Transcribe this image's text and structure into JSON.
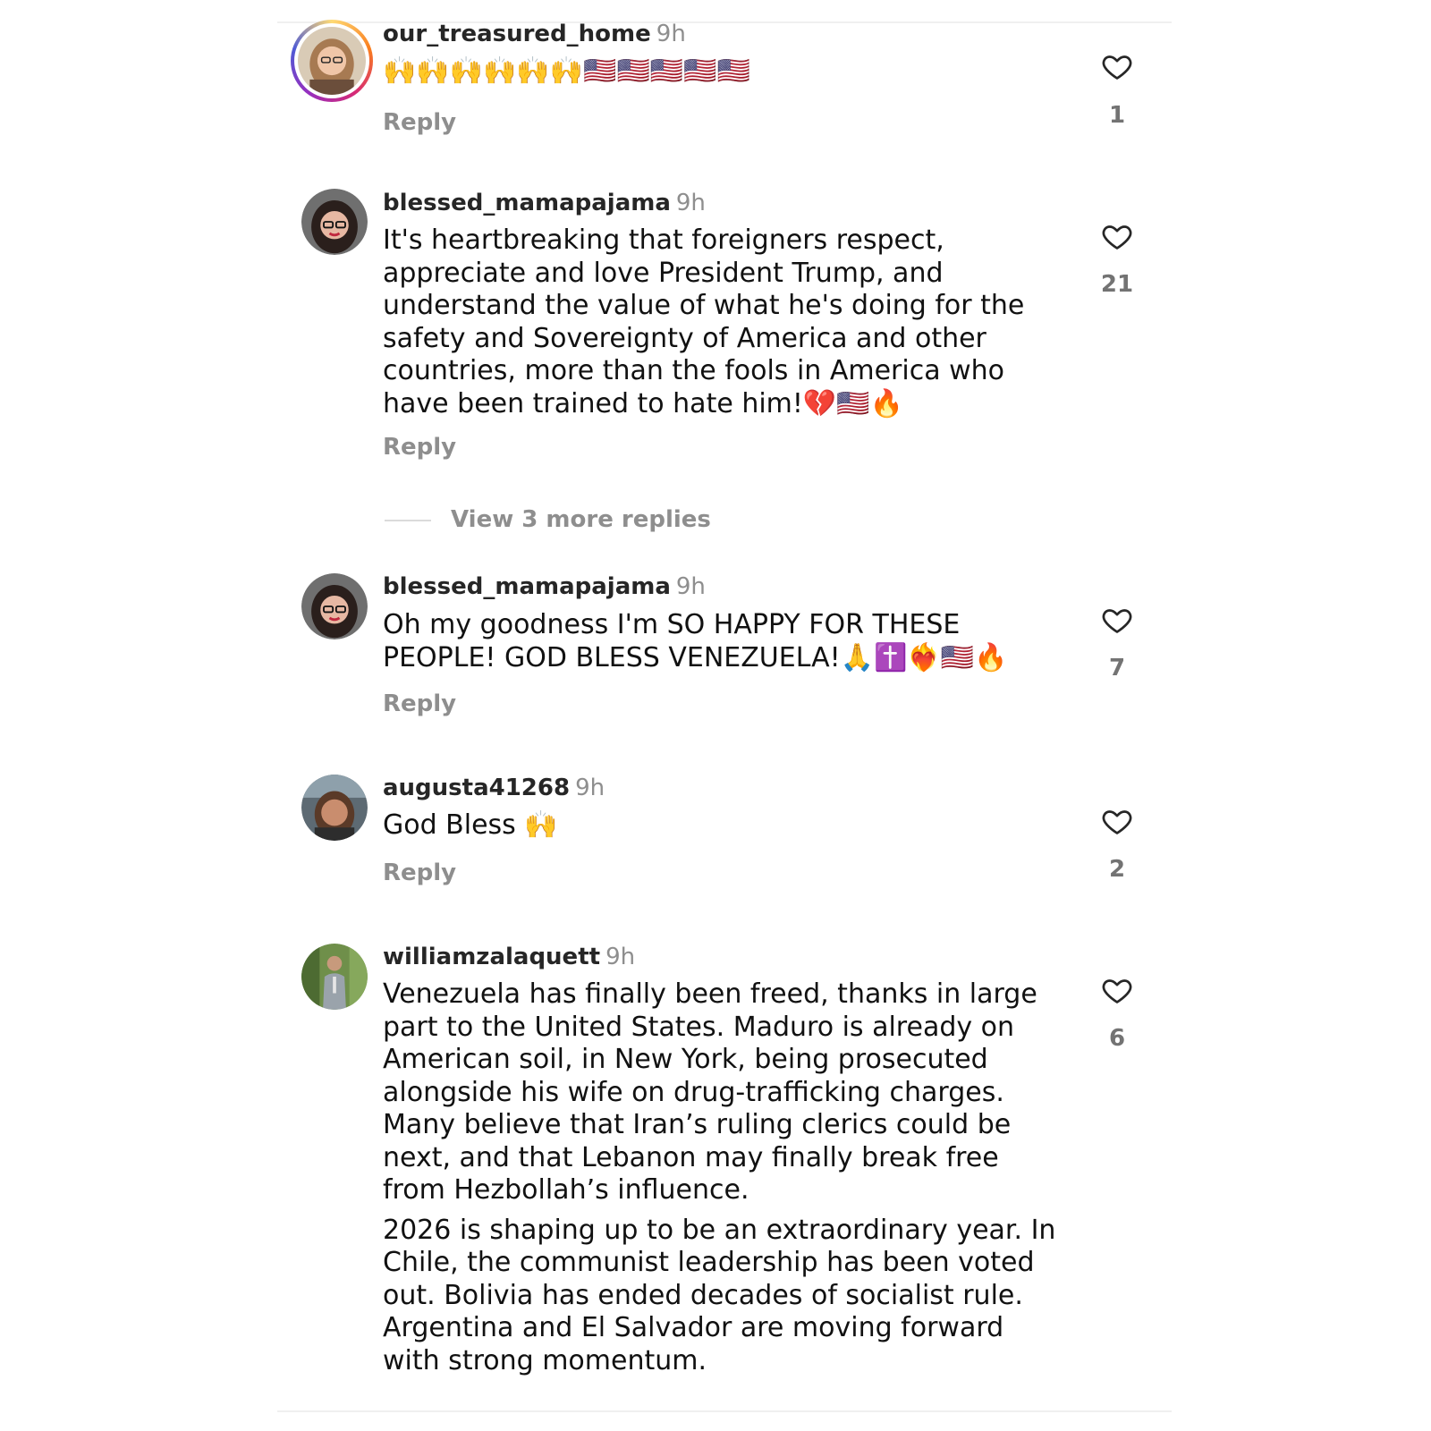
{
  "reply_label": "Reply",
  "view_more_replies": "View 3 more replies",
  "comments": [
    {
      "username": "our_treasured_home",
      "time": "9h",
      "paragraphs": [
        "🙌🙌🙌🙌🙌🙌🇺🇸🇺🇸🇺🇸🇺🇸🇺🇸"
      ],
      "likes": "1",
      "story_ring": true
    },
    {
      "username": "blessed_mamapajama",
      "time": "9h",
      "paragraphs": [
        "It's heartbreaking that foreigners respect, appreciate and love President Trump, and understand the value of what he's doing for the safety and Sovereignty of America and other countries,  more than the fools in America who have been trained to hate him!💔🇺🇸🔥"
      ],
      "likes": "21"
    },
    {
      "username": "blessed_mamapajama",
      "time": "9h",
      "paragraphs": [
        "Oh my goodness I'm SO HAPPY FOR THESE PEOPLE! GOD BLESS VENEZUELA!🙏✝️❤️‍🔥🇺🇸🔥"
      ],
      "likes": "7"
    },
    {
      "username": "augusta41268",
      "time": "9h",
      "paragraphs": [
        "God Bless 🙌"
      ],
      "likes": "2"
    },
    {
      "username": "williamzalaquett",
      "time": "9h",
      "paragraphs": [
        "Venezuela has finally been freed, thanks in large part to the United States. Maduro is already on American soil, in New York, being prosecuted alongside his wife on drug-trafficking charges. Many believe that Iran’s ruling clerics could be next, and that Lebanon may finally break free from Hezbollah’s influence.",
        "2026 is shaping up to be an extraordinary year. In Chile, the communist leadership has been voted out. Bolivia has ended decades of socialist rule. Argentina and El Salvador are moving forward with strong momentum."
      ],
      "likes": "6"
    }
  ],
  "colors": {
    "username": "#262626",
    "meta": "#8e8e8e",
    "text": "#111111",
    "story_ring": [
      "#feda75",
      "#fa7e1e",
      "#d62976",
      "#962fbf",
      "#4f5bd5"
    ]
  },
  "icons": {
    "like": "heart-outline-icon"
  }
}
